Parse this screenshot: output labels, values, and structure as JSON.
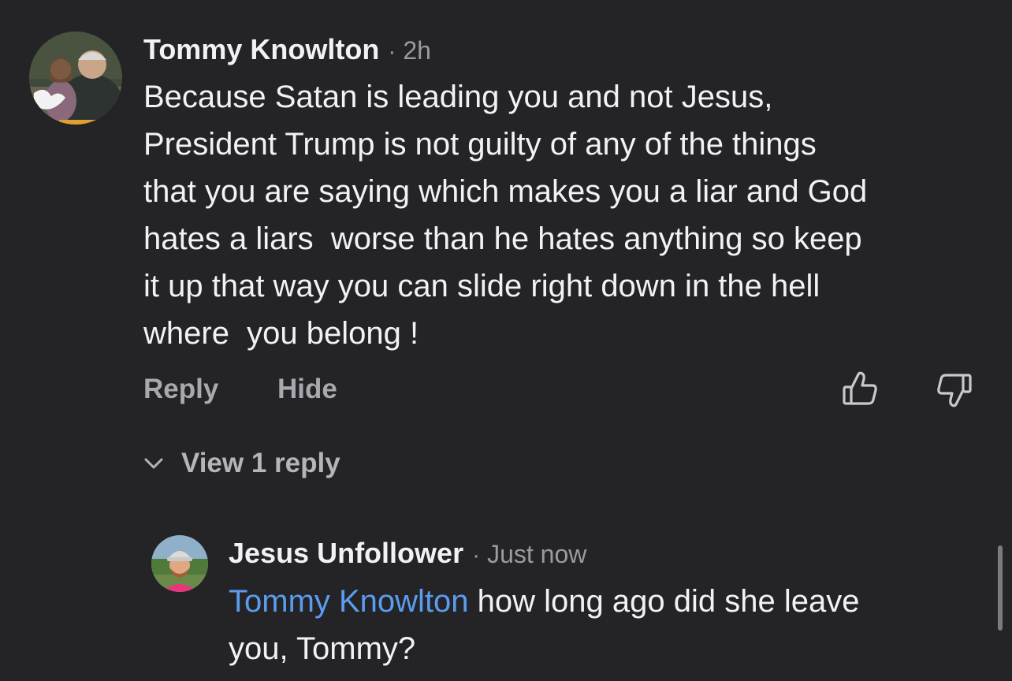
{
  "comment": {
    "author": "Tommy Knowlton",
    "separator": "·",
    "time": "2h",
    "text": "Because Satan is leading you and not Jesus,\nPresident Trump is not guilty of any of the things\nthat you are saying which makes you a liar and God\nhates a liars  worse than he hates anything so keep\nit up that way you can slide right down in the hell\nwhere  you belong !",
    "actions": {
      "reply_label": "Reply",
      "hide_label": "Hide"
    },
    "like_icon": "thumbs-up-icon",
    "dislike_icon": "thumbs-down-icon",
    "view_replies_label": "View 1 reply"
  },
  "reply": {
    "author": "Jesus Unfollower",
    "separator": "·",
    "time": "Just now",
    "mention": "Tommy Knowlton",
    "text_line1": " how long ago did she leave",
    "text_line2": "you, Tommy?"
  },
  "colors": {
    "background": "#242427",
    "text": "#f2f2f4",
    "muted": "#9a9aa0",
    "mention": "#5b9cf0"
  }
}
